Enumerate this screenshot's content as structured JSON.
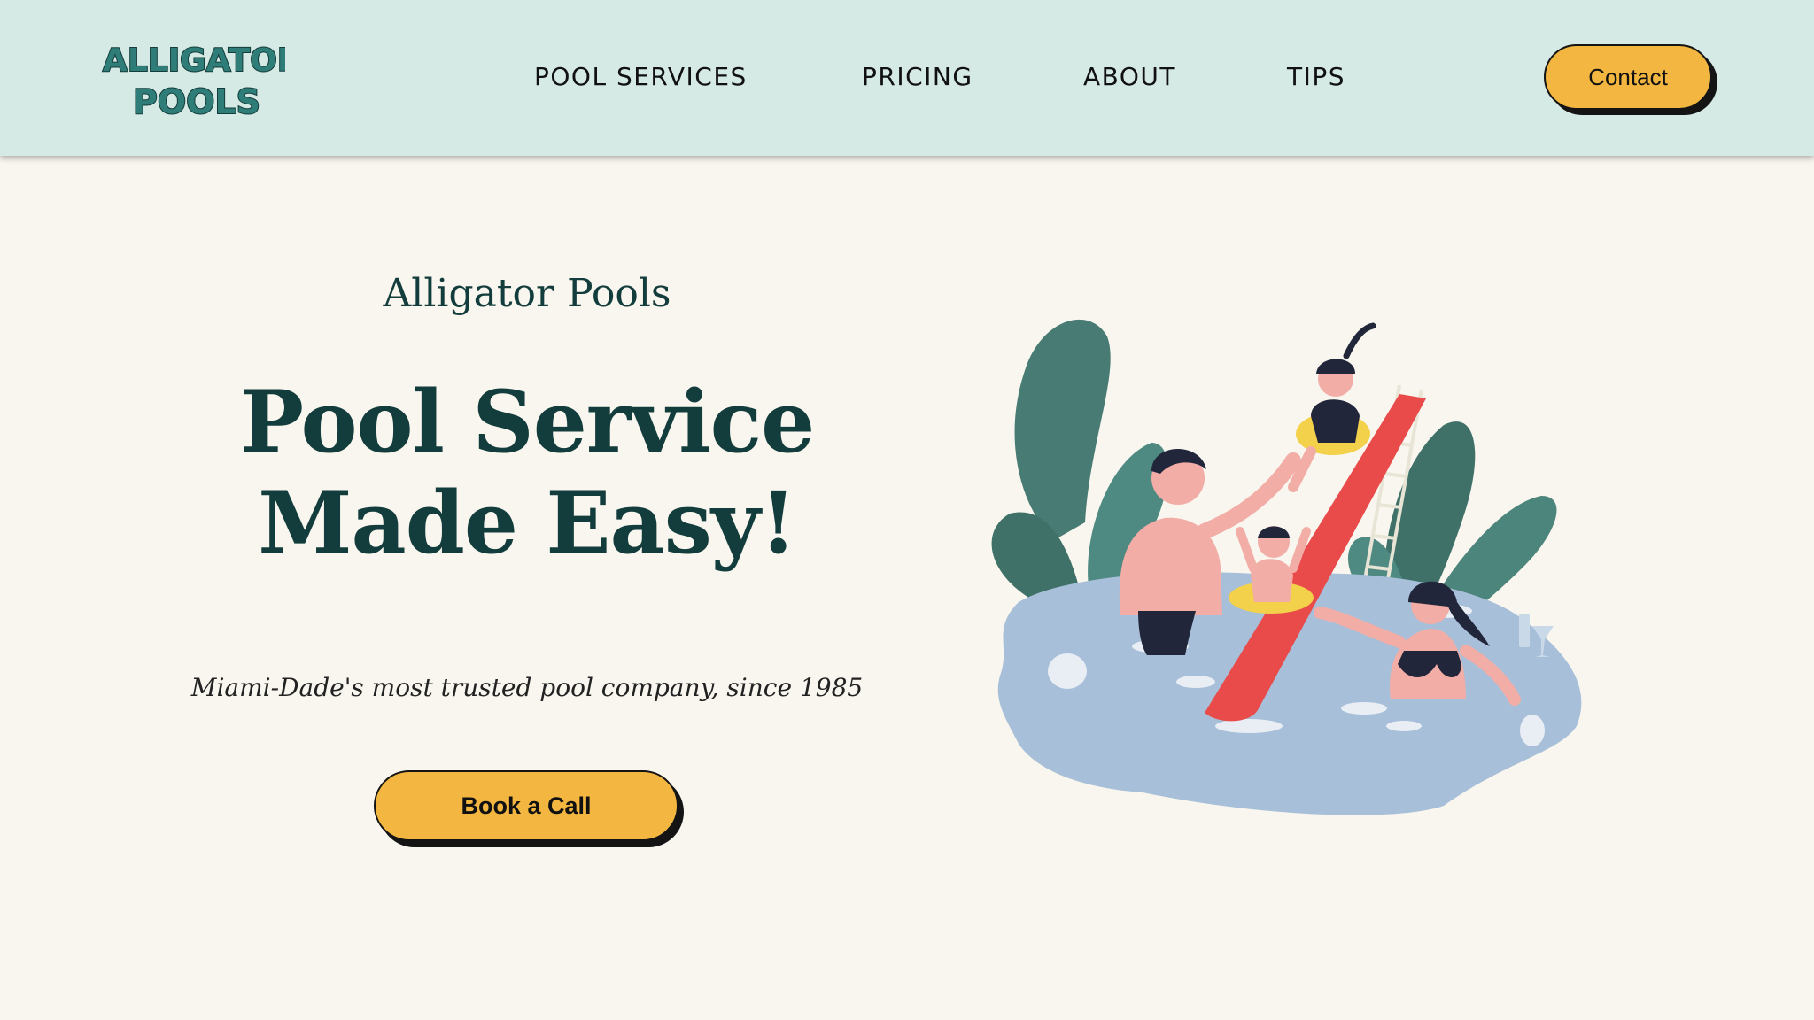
{
  "header": {
    "logo": {
      "line1": "ALLIGATOR",
      "line2": "POOLS",
      "icon": "alligator-pools-logo"
    },
    "nav": [
      {
        "label": "POOL SERVICES"
      },
      {
        "label": "PRICING"
      },
      {
        "label": "ABOUT"
      },
      {
        "label": "TIPS"
      }
    ],
    "contact_label": "Contact"
  },
  "hero": {
    "eyebrow": "Alligator Pools",
    "headline_line1": "Pool Service",
    "headline_line2": "Made Easy!",
    "tagline": "Miami-Dade's most trusted pool company, since 1985",
    "cta_label": "Book a Call",
    "illustration": "family-at-pool-with-slide-illustration"
  },
  "colors": {
    "header_bg": "#d5e9e5",
    "page_bg": "#f8f6ee",
    "accent": "#f2b641",
    "heading": "#133c3c",
    "logo": "#2f7d78"
  }
}
